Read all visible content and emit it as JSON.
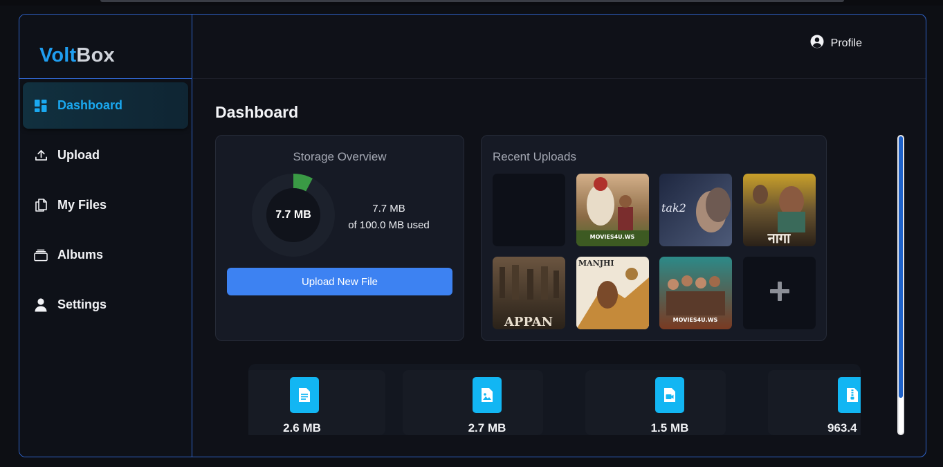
{
  "app": {
    "logo_part1": "Volt",
    "logo_part2": "Box"
  },
  "sidebar": {
    "items": [
      {
        "label": "Dashboard",
        "icon": "dashboard-icon",
        "active": true
      },
      {
        "label": "Upload",
        "icon": "upload-icon",
        "active": false
      },
      {
        "label": "My Files",
        "icon": "files-icon",
        "active": false
      },
      {
        "label": "Albums",
        "icon": "albums-icon",
        "active": false
      },
      {
        "label": "Settings",
        "icon": "user-icon",
        "active": false
      }
    ]
  },
  "header": {
    "profile_label": "Profile"
  },
  "page": {
    "title": "Dashboard"
  },
  "storage": {
    "title": "Storage Overview",
    "used_display": "7.7 MB",
    "used_line": "7.7 MB",
    "total_line": "of 100.0 MB used",
    "used_fraction": 0.077,
    "upload_button": "Upload New File"
  },
  "recent": {
    "title": "Recent Uploads",
    "thumbnails": [
      {
        "name": "thumbnail-empty",
        "text": ""
      },
      {
        "name": "thumbnail-poster",
        "text": "MOVIES4U.WS"
      },
      {
        "name": "thumbnail-poster",
        "text": "tak2"
      },
      {
        "name": "thumbnail-poster",
        "text": "नागा"
      },
      {
        "name": "thumbnail-poster",
        "text": "APPAN"
      },
      {
        "name": "thumbnail-poster",
        "text": "MANJHI"
      },
      {
        "name": "thumbnail-poster",
        "text": "MOVIES4U.WS"
      }
    ]
  },
  "stats": [
    {
      "icon": "document-file-icon",
      "value": "2.6 MB"
    },
    {
      "icon": "image-file-icon",
      "value": "2.7 MB"
    },
    {
      "icon": "video-file-icon",
      "value": "1.5 MB"
    },
    {
      "icon": "archive-file-icon",
      "value": "963.4"
    }
  ],
  "colors": {
    "accent": "#1aa8f0",
    "border": "#2f63c9",
    "button": "#3d82f2",
    "storage_used": "#3a9a45",
    "stat_icon": "#12b6f3"
  }
}
